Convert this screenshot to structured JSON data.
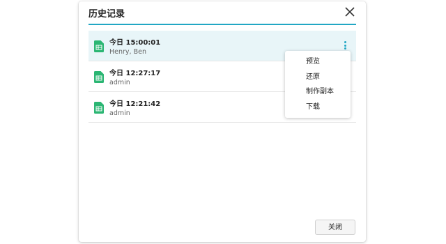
{
  "dialog": {
    "title": "历史记录",
    "close_button_label": "关闭",
    "accent_color": "#22a7c4",
    "file_icon_color": "#2bb673"
  },
  "history": [
    {
      "time": "今日 15:00:01",
      "user": "Henry, Ben",
      "icon": "spreadsheet-icon",
      "selected": true
    },
    {
      "time": "今日 12:27:17",
      "user": "admin",
      "icon": "spreadsheet-icon",
      "selected": false
    },
    {
      "time": "今日 12:21:42",
      "user": "admin",
      "icon": "spreadsheet-icon",
      "selected": false
    }
  ],
  "context_menu": {
    "items": [
      "预览",
      "还原",
      "制作副本",
      "下载"
    ]
  }
}
